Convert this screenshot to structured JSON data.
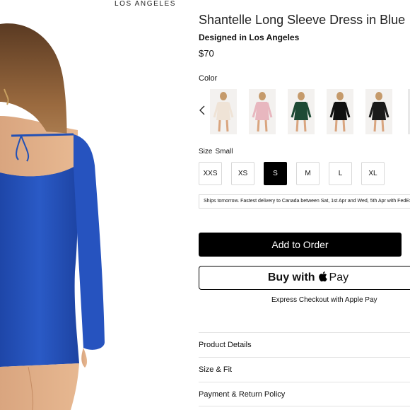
{
  "brand": "LOS ANGELES",
  "product": {
    "title": "Shantelle Long Sleeve Dress in Blue",
    "designed": "Designed in Los Angeles",
    "price": "$70"
  },
  "color": {
    "label": "Color",
    "swatches": [
      {
        "name": "cream dress",
        "color": "#efe3d6"
      },
      {
        "name": "pink dress",
        "color": "#e8b7bf"
      },
      {
        "name": "green dress",
        "color": "#1e4a35"
      },
      {
        "name": "black dress",
        "color": "#111111"
      },
      {
        "name": "black sequin dress",
        "color": "#1a1a1a"
      }
    ]
  },
  "size": {
    "label": "Size",
    "selected": "Small",
    "options": [
      "XXS",
      "XS",
      "S",
      "M",
      "L",
      "XL"
    ]
  },
  "shipping_note": "Ships tomorrow. Fastest delivery to Canada between Sat, 1st Apr and Wed, 5th Apr with FedEx",
  "buttons": {
    "add_to_order": "Add to Order",
    "buy_with": "Buy with",
    "pay": "Pay",
    "express": "Express Checkout with Apple Pay"
  },
  "accordion": [
    "Product Details",
    "Size & Fit",
    "Payment & Return Policy"
  ],
  "colors": {
    "dress_blue": "#2550b8",
    "accent": "#000000"
  }
}
